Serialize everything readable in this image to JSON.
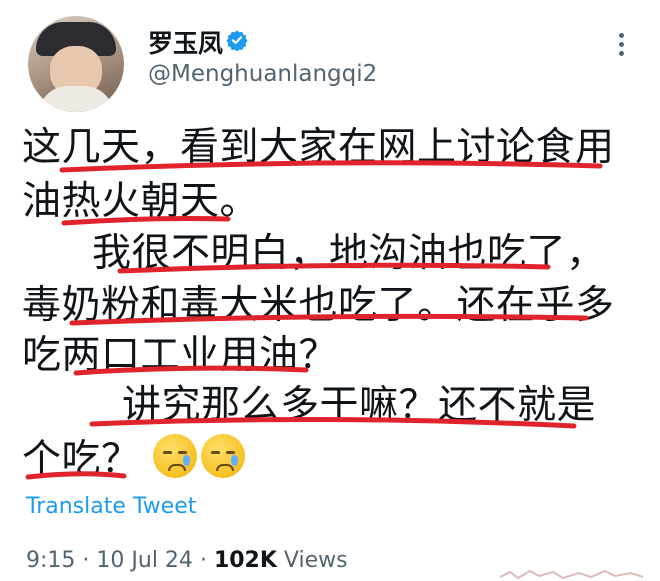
{
  "author": {
    "name": "罗玉凤",
    "handle": "@Menghuanlangqi2",
    "verified": true
  },
  "tweet": {
    "lines": [
      "这几天，看到大家在网上讨论食用",
      "油热火朝天。",
      "我很不明白，地沟油也吃了，",
      "毒奶粉和毒大米也吃了。还在乎多",
      "吃两口工业用油？",
      "讲究那么多干嘛？还不就是",
      "个吃？"
    ],
    "emojis": [
      "sad-relieved-face",
      "sad-relieved-face"
    ],
    "translate_label": "Translate Tweet",
    "time": "9:15",
    "date": "10 Jul 24",
    "views_count": "102K",
    "views_label": "Views"
  },
  "colors": {
    "text": "#0f1419",
    "secondary": "#536471",
    "link": "#1d9bf0",
    "verified": "#1d9bf0",
    "underline_marks": "#e0242b"
  }
}
